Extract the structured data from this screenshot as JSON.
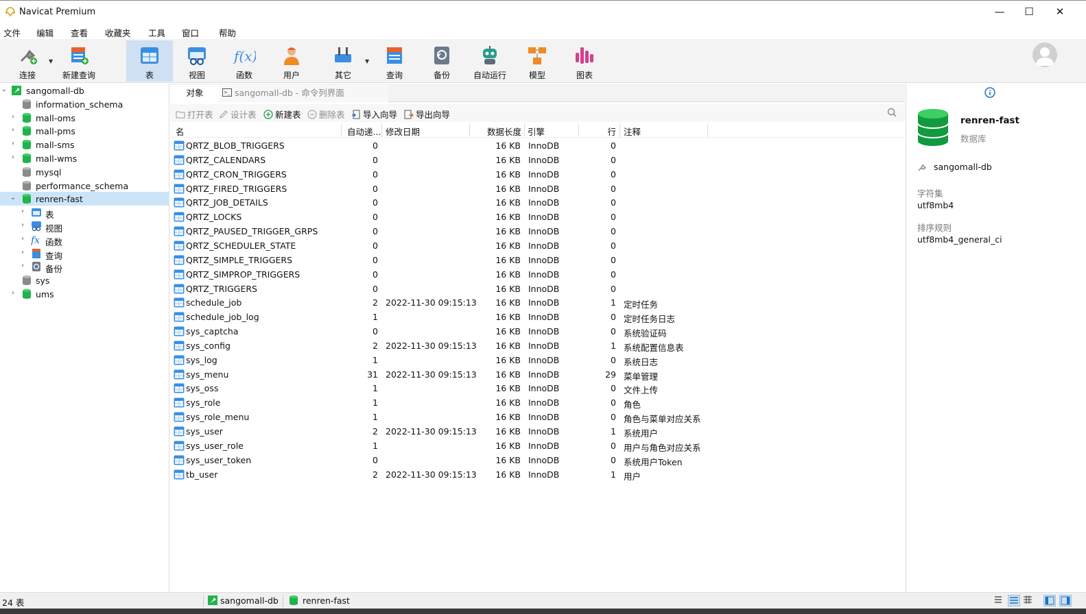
{
  "window": {
    "title": "Navicat Premium",
    "controls": [
      "—",
      "☐",
      "✕"
    ]
  },
  "menu": [
    "文件",
    "编辑",
    "查看",
    "收藏夹",
    "工具",
    "窗口",
    "帮助"
  ],
  "toolbar": {
    "buttons": [
      {
        "label": "连接",
        "icon": "plug-icon"
      },
      {
        "label": "新建查询",
        "icon": "new-query-icon"
      },
      {
        "label": "表",
        "icon": "table-icon",
        "active": true
      },
      {
        "label": "视图",
        "icon": "view-icon"
      },
      {
        "label": "函数",
        "icon": "function-icon",
        "glyph": "f(x)"
      },
      {
        "label": "用户",
        "icon": "user-icon"
      },
      {
        "label": "其它",
        "icon": "tools-icon"
      },
      {
        "label": "查询",
        "icon": "query-icon"
      },
      {
        "label": "备份",
        "icon": "backup-icon"
      },
      {
        "label": "自动运行",
        "icon": "robot-icon"
      },
      {
        "label": "模型",
        "icon": "model-icon"
      },
      {
        "label": "图表",
        "icon": "chart-icon"
      }
    ]
  },
  "sidebar": {
    "connection": "sangomall-db",
    "databases": [
      {
        "name": "information_schema",
        "color": "gray",
        "caret": ""
      },
      {
        "name": "mall-oms",
        "color": "green",
        "caret": "›"
      },
      {
        "name": "mall-pms",
        "color": "green",
        "caret": "›"
      },
      {
        "name": "mall-sms",
        "color": "green",
        "caret": "›"
      },
      {
        "name": "mall-wms",
        "color": "green",
        "caret": "›"
      },
      {
        "name": "mysql",
        "color": "gray",
        "caret": ""
      },
      {
        "name": "performance_schema",
        "color": "gray",
        "caret": ""
      },
      {
        "name": "renren-fast",
        "color": "green",
        "caret": "⌄",
        "selected": true
      },
      {
        "name": "sys",
        "color": "gray",
        "caret": ""
      },
      {
        "name": "ums",
        "color": "green",
        "caret": "›"
      }
    ],
    "children": [
      {
        "label": "表",
        "icon": "table-icon"
      },
      {
        "label": "视图",
        "icon": "view-icon"
      },
      {
        "label": "函数",
        "icon": "function-icon"
      },
      {
        "label": "查询",
        "icon": "query-icon"
      },
      {
        "label": "备份",
        "icon": "backup-icon"
      }
    ]
  },
  "tabs": {
    "objects": "对象",
    "cmd": "sangomall-db - 命令列界面"
  },
  "object_bar": {
    "open": "打开表",
    "design": "设计表",
    "new": "新建表",
    "delete": "删除表",
    "import": "导入向导",
    "export": "导出向导"
  },
  "grid": {
    "headers": {
      "name": "名",
      "auto_inc": "自动递...",
      "modified": "修改日期",
      "data_length": "数据长度",
      "engine": "引擎",
      "rows": "行",
      "comment": "注释"
    },
    "rows": [
      {
        "name": "QRTZ_BLOB_TRIGGERS",
        "auto_inc": "0",
        "modified": "",
        "data_length": "16 KB",
        "engine": "InnoDB",
        "rows": "0",
        "comment": ""
      },
      {
        "name": "QRTZ_CALENDARS",
        "auto_inc": "0",
        "modified": "",
        "data_length": "16 KB",
        "engine": "InnoDB",
        "rows": "0",
        "comment": ""
      },
      {
        "name": "QRTZ_CRON_TRIGGERS",
        "auto_inc": "0",
        "modified": "",
        "data_length": "16 KB",
        "engine": "InnoDB",
        "rows": "0",
        "comment": ""
      },
      {
        "name": "QRTZ_FIRED_TRIGGERS",
        "auto_inc": "0",
        "modified": "",
        "data_length": "16 KB",
        "engine": "InnoDB",
        "rows": "0",
        "comment": ""
      },
      {
        "name": "QRTZ_JOB_DETAILS",
        "auto_inc": "0",
        "modified": "",
        "data_length": "16 KB",
        "engine": "InnoDB",
        "rows": "0",
        "comment": ""
      },
      {
        "name": "QRTZ_LOCKS",
        "auto_inc": "0",
        "modified": "",
        "data_length": "16 KB",
        "engine": "InnoDB",
        "rows": "0",
        "comment": ""
      },
      {
        "name": "QRTZ_PAUSED_TRIGGER_GRPS",
        "auto_inc": "0",
        "modified": "",
        "data_length": "16 KB",
        "engine": "InnoDB",
        "rows": "0",
        "comment": ""
      },
      {
        "name": "QRTZ_SCHEDULER_STATE",
        "auto_inc": "0",
        "modified": "",
        "data_length": "16 KB",
        "engine": "InnoDB",
        "rows": "0",
        "comment": ""
      },
      {
        "name": "QRTZ_SIMPLE_TRIGGERS",
        "auto_inc": "0",
        "modified": "",
        "data_length": "16 KB",
        "engine": "InnoDB",
        "rows": "0",
        "comment": ""
      },
      {
        "name": "QRTZ_SIMPROP_TRIGGERS",
        "auto_inc": "0",
        "modified": "",
        "data_length": "16 KB",
        "engine": "InnoDB",
        "rows": "0",
        "comment": ""
      },
      {
        "name": "QRTZ_TRIGGERS",
        "auto_inc": "0",
        "modified": "",
        "data_length": "16 KB",
        "engine": "InnoDB",
        "rows": "0",
        "comment": ""
      },
      {
        "name": "schedule_job",
        "auto_inc": "2",
        "modified": "2022-11-30 09:15:13",
        "data_length": "16 KB",
        "engine": "InnoDB",
        "rows": "1",
        "comment": "定时任务"
      },
      {
        "name": "schedule_job_log",
        "auto_inc": "1",
        "modified": "",
        "data_length": "16 KB",
        "engine": "InnoDB",
        "rows": "0",
        "comment": "定时任务日志"
      },
      {
        "name": "sys_captcha",
        "auto_inc": "0",
        "modified": "",
        "data_length": "16 KB",
        "engine": "InnoDB",
        "rows": "0",
        "comment": "系统验证码"
      },
      {
        "name": "sys_config",
        "auto_inc": "2",
        "modified": "2022-11-30 09:15:13",
        "data_length": "16 KB",
        "engine": "InnoDB",
        "rows": "1",
        "comment": "系统配置信息表"
      },
      {
        "name": "sys_log",
        "auto_inc": "1",
        "modified": "",
        "data_length": "16 KB",
        "engine": "InnoDB",
        "rows": "0",
        "comment": "系统日志"
      },
      {
        "name": "sys_menu",
        "auto_inc": "31",
        "modified": "2022-11-30 09:15:13",
        "data_length": "16 KB",
        "engine": "InnoDB",
        "rows": "29",
        "comment": "菜单管理"
      },
      {
        "name": "sys_oss",
        "auto_inc": "1",
        "modified": "",
        "data_length": "16 KB",
        "engine": "InnoDB",
        "rows": "0",
        "comment": "文件上传"
      },
      {
        "name": "sys_role",
        "auto_inc": "1",
        "modified": "",
        "data_length": "16 KB",
        "engine": "InnoDB",
        "rows": "0",
        "comment": "角色"
      },
      {
        "name": "sys_role_menu",
        "auto_inc": "1",
        "modified": "",
        "data_length": "16 KB",
        "engine": "InnoDB",
        "rows": "0",
        "comment": "角色与菜单对应关系"
      },
      {
        "name": "sys_user",
        "auto_inc": "2",
        "modified": "2022-11-30 09:15:13",
        "data_length": "16 KB",
        "engine": "InnoDB",
        "rows": "1",
        "comment": "系统用户"
      },
      {
        "name": "sys_user_role",
        "auto_inc": "1",
        "modified": "",
        "data_length": "16 KB",
        "engine": "InnoDB",
        "rows": "0",
        "comment": "用户与角色对应关系"
      },
      {
        "name": "sys_user_token",
        "auto_inc": "0",
        "modified": "",
        "data_length": "16 KB",
        "engine": "InnoDB",
        "rows": "0",
        "comment": "系统用户Token"
      },
      {
        "name": "tb_user",
        "auto_inc": "2",
        "modified": "2022-11-30 09:15:13",
        "data_length": "16 KB",
        "engine": "InnoDB",
        "rows": "1",
        "comment": "用户"
      }
    ]
  },
  "info_panel": {
    "db_name": "renren-fast",
    "db_type": "数据库",
    "connection": "sangomall-db",
    "charset_label": "字符集",
    "charset": "utf8mb4",
    "collation_label": "排序规则",
    "collation": "utf8mb4_general_ci"
  },
  "status": {
    "count": "24 表",
    "connection": "sangomall-db",
    "database": "renren-fast"
  },
  "colors": {
    "accent": "#1a73c7",
    "db_green": "#21b24b",
    "db_gray": "#8a8a8a",
    "selection": "#cce4f7",
    "toolbar_active": "#cfe0f3"
  }
}
